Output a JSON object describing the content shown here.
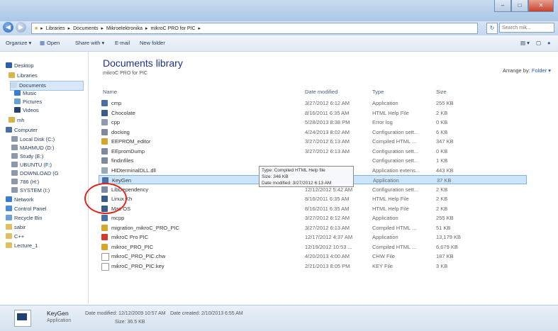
{
  "address": {
    "crumbs": [
      "Libraries",
      "Documents",
      "Mikroelektronika",
      "mikroC PRO for PIC"
    ],
    "search_placeholder": "Search mik..."
  },
  "toolbar": {
    "organize": "Organize ▾",
    "open": "Open",
    "share": "Share with ▾",
    "email": "E-mail",
    "new_folder": "New folder"
  },
  "nav": [
    {
      "label": "Desktop",
      "icon": "desktop-icon",
      "color": "#2d5fa8"
    },
    {
      "label": "Libraries",
      "icon": "libraries-icon",
      "color": "#d8b44a"
    },
    {
      "label": "Documents",
      "icon": "documents-icon",
      "color": "#c9d8ea"
    },
    {
      "label": "Music",
      "icon": "music-icon",
      "color": "#3a7bd5"
    },
    {
      "label": "Pictures",
      "icon": "pictures-icon",
      "color": "#6aa0d8"
    },
    {
      "label": "Videos",
      "icon": "videos-icon",
      "color": "#2a3f6a"
    },
    {
      "label": "mh",
      "icon": "user-folder-icon",
      "color": "#d8b44a"
    },
    {
      "label": "Computer",
      "icon": "computer-icon",
      "color": "#4a6fa5"
    },
    {
      "label": "Local Disk (C:)",
      "icon": "drive-icon",
      "color": "#8c99a8"
    },
    {
      "label": "MAHMUD (D:)",
      "icon": "drive-icon",
      "color": "#8c99a8"
    },
    {
      "label": "Study (E:)",
      "icon": "drive-icon",
      "color": "#8c99a8"
    },
    {
      "label": "UBUNTU (F:)",
      "icon": "drive-icon",
      "color": "#8c99a8"
    },
    {
      "label": "DOWNLOAD (G",
      "icon": "drive-icon",
      "color": "#8c99a8"
    },
    {
      "label": "786 (H:)",
      "icon": "drive-icon",
      "color": "#8c99a8"
    },
    {
      "label": "SYSTEM (I:)",
      "icon": "drive-icon",
      "color": "#8c99a8"
    },
    {
      "label": "Network",
      "icon": "network-icon",
      "color": "#3a7bd5"
    },
    {
      "label": "Control Panel",
      "icon": "control-panel-icon",
      "color": "#4a8bd5"
    },
    {
      "label": "Recycle Bin",
      "icon": "recycle-bin-icon",
      "color": "#6aa0d8"
    },
    {
      "label": "sabir",
      "icon": "folder-icon",
      "color": "#e0c060"
    },
    {
      "label": "C++",
      "icon": "folder-icon",
      "color": "#e0c060"
    },
    {
      "label": "Lecture_1",
      "icon": "folder-icon",
      "color": "#e0c060"
    }
  ],
  "library": {
    "title": "Documents library",
    "subtitle": "mikroC PRO for PIC",
    "arrange_label": "Arrange by:",
    "arrange_value": "Folder ▾"
  },
  "columns": {
    "name": "Name",
    "date": "Date modified",
    "type": "Type",
    "size": "Size"
  },
  "files": [
    {
      "name": "cmp",
      "date": "3/27/2012 6:12 AM",
      "type": "Application",
      "size": "255 KB",
      "color": "#4a6fa5"
    },
    {
      "name": "Chocolate",
      "date": "8/16/2011 6:35 AM",
      "type": "HTML Help File",
      "size": "2 KB",
      "color": "#3b5b8a"
    },
    {
      "name": "cpp",
      "date": "5/28/2013 8:38 PM",
      "type": "Error log",
      "size": "0 KB",
      "color": "#8f9cae"
    },
    {
      "name": "docking",
      "date": "4/24/2013 8:02 AM",
      "type": "Configuration sett...",
      "size": "6 KB",
      "color": "#7c8ba0"
    },
    {
      "name": "EEPROM_editor",
      "date": "3/27/2012 6:13 AM",
      "type": "Compiled HTML ...",
      "size": "347 KB",
      "color": "#d4a72c"
    },
    {
      "name": "EEpromDump",
      "date": "3/27/2012 6:13 AM",
      "type": "Configuration sett...",
      "size": "0 KB",
      "color": "#7c8ba0"
    },
    {
      "name": "findinfiles",
      "date": "",
      "type": "Configuration sett...",
      "size": "1 KB",
      "color": "#7c8ba0"
    },
    {
      "name": "HIDterminalDLL.dll",
      "date": "",
      "type": "Application extens...",
      "size": "443 KB",
      "color": "#9aa8b8"
    },
    {
      "name": "KeyGen",
      "date": "12/12/2009 10:57 ...",
      "type": "Application",
      "size": "37 KB",
      "color": "#4a6fa5"
    },
    {
      "name": "LibDependency",
      "date": "12/12/2012 5:42 AM",
      "type": "Configuration sett...",
      "size": "2 KB",
      "color": "#7c8ba0"
    },
    {
      "name": "Linux Kh",
      "date": "8/16/2011 6:35 AM",
      "type": "HTML Help File",
      "size": "2 KB",
      "color": "#3b5b8a"
    },
    {
      "name": "Mac OS",
      "date": "8/16/2011 6:35 AM",
      "type": "HTML Help File",
      "size": "2 KB",
      "color": "#3b5b8a"
    },
    {
      "name": "mcpp",
      "date": "3/27/2012 6:12 AM",
      "type": "Application",
      "size": "255 KB",
      "color": "#4a6fa5"
    },
    {
      "name": "migration_mikroC_PRO_PIC",
      "date": "3/27/2012 6:13 AM",
      "type": "Compiled HTML ...",
      "size": "51 KB",
      "color": "#d4a72c"
    },
    {
      "name": "mikroC Pro PIC",
      "date": "12/17/2012 4:37 AM",
      "type": "Application",
      "size": "13,179 KB",
      "color": "#d33a2c"
    },
    {
      "name": "mikroc_PRO_PIC",
      "date": "12/19/2012 10:53 ...",
      "type": "Compiled HTML ...",
      "size": "6,679 KB",
      "color": "#d4a72c"
    },
    {
      "name": "mikroC_PRO_PIC.chw",
      "date": "4/20/2013 4:00 AM",
      "type": "CHW File",
      "size": "187 KB",
      "color": "#ffffff"
    },
    {
      "name": "mikroC_PRO_PIC.key",
      "date": "2/21/2013 8:05 PM",
      "type": "KEY File",
      "size": "3 KB",
      "color": "#ffffff"
    }
  ],
  "tooltip": {
    "line1": "Type: Compiled HTML Help file",
    "line2": "Size: 346 KB",
    "line3": "Date modified: 3/27/2012 6:13 AM"
  },
  "details": {
    "name": "KeyGen",
    "type": "Application",
    "modified": "Date modified: 12/12/2009 10:57 AM",
    "created": "Date created: 2/10/2013 6:55 AM",
    "size": "Size: 36.5 KB"
  }
}
